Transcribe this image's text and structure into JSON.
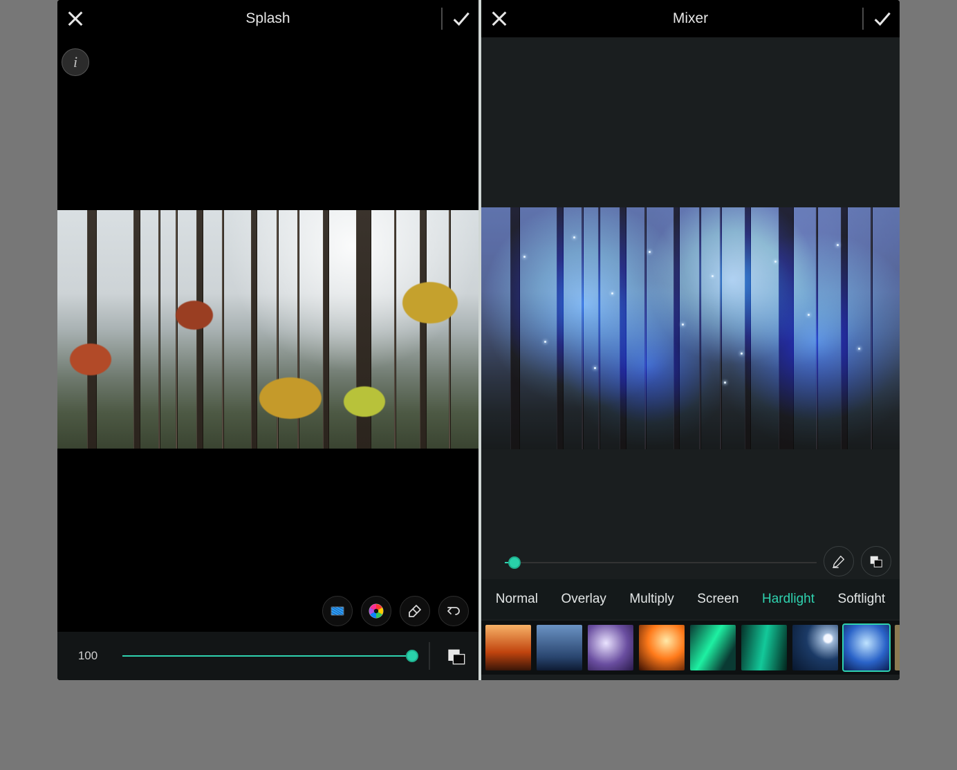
{
  "left": {
    "title": "Splash",
    "info_icon": "i",
    "tools": {
      "shape": "shape-icon",
      "color_picker": "color-wheel-icon",
      "eraser": "eraser-icon",
      "undo": "undo-icon"
    },
    "slider": {
      "value": 100,
      "min": 0,
      "max": 100,
      "percent": 100
    },
    "fx_icon": "mask-swap-icon"
  },
  "right": {
    "title": "Mixer",
    "slider": {
      "value": 3,
      "min": 0,
      "max": 100,
      "percent": 3
    },
    "tools": {
      "brush": "brush-icon",
      "swap": "mask-swap-icon"
    },
    "page_dots": 1,
    "blend_modes": [
      {
        "label": "Normal",
        "active": false
      },
      {
        "label": "Overlay",
        "active": false
      },
      {
        "label": "Multiply",
        "active": false
      },
      {
        "label": "Screen",
        "active": false
      },
      {
        "label": "Hardlight",
        "active": true
      },
      {
        "label": "Softlight",
        "active": false
      }
    ],
    "overlays": [
      {
        "name": "sunset-clouds",
        "selected": false,
        "css": "linear-gradient(#f7b267,#c1440e 60%,#3a1608)"
      },
      {
        "name": "storm-sky",
        "selected": false,
        "css": "linear-gradient(#6b93c4,#2a4670 70%,#0e1b33)"
      },
      {
        "name": "lightning-purple",
        "selected": false,
        "css": "radial-gradient(circle at 40% 40%,#eae3ff,#6a4ea0 55%,#2a1a4a)"
      },
      {
        "name": "fire-sky",
        "selected": false,
        "css": "radial-gradient(circle at 60% 35%,#ffe9a8,#ff7a1a 45%,#3a0f02)"
      },
      {
        "name": "aurora-green",
        "selected": false,
        "css": "linear-gradient(120deg,#0a3a33,#1ef0a2 45%,#0a3a33 80%)"
      },
      {
        "name": "aurora-teal",
        "selected": false,
        "css": "linear-gradient(100deg,#053028,#13c99a 50%,#02231c)"
      },
      {
        "name": "moon-night",
        "selected": false,
        "css": "radial-gradient(circle at 78% 30%,#f4f7ff 0 8%,#9db7d6 12%,#1b3a66 45%,#08172e)"
      },
      {
        "name": "blue-sparkle",
        "selected": true,
        "css": "radial-gradient(circle at 50% 40%,#bfe3ff,#2a63c8 55%,#0a1e52)"
      },
      {
        "name": "bokeh-gold",
        "selected": false,
        "css": "radial-gradient(circle at 30% 30%,#f4e2b6 0 12%,transparent 13%),radial-gradient(circle at 65% 55%,#e8d29b 0 14%,transparent 15%),radial-gradient(circle at 50% 75%,#d8c184 0 10%,transparent 11%),#8a7a52"
      }
    ]
  }
}
